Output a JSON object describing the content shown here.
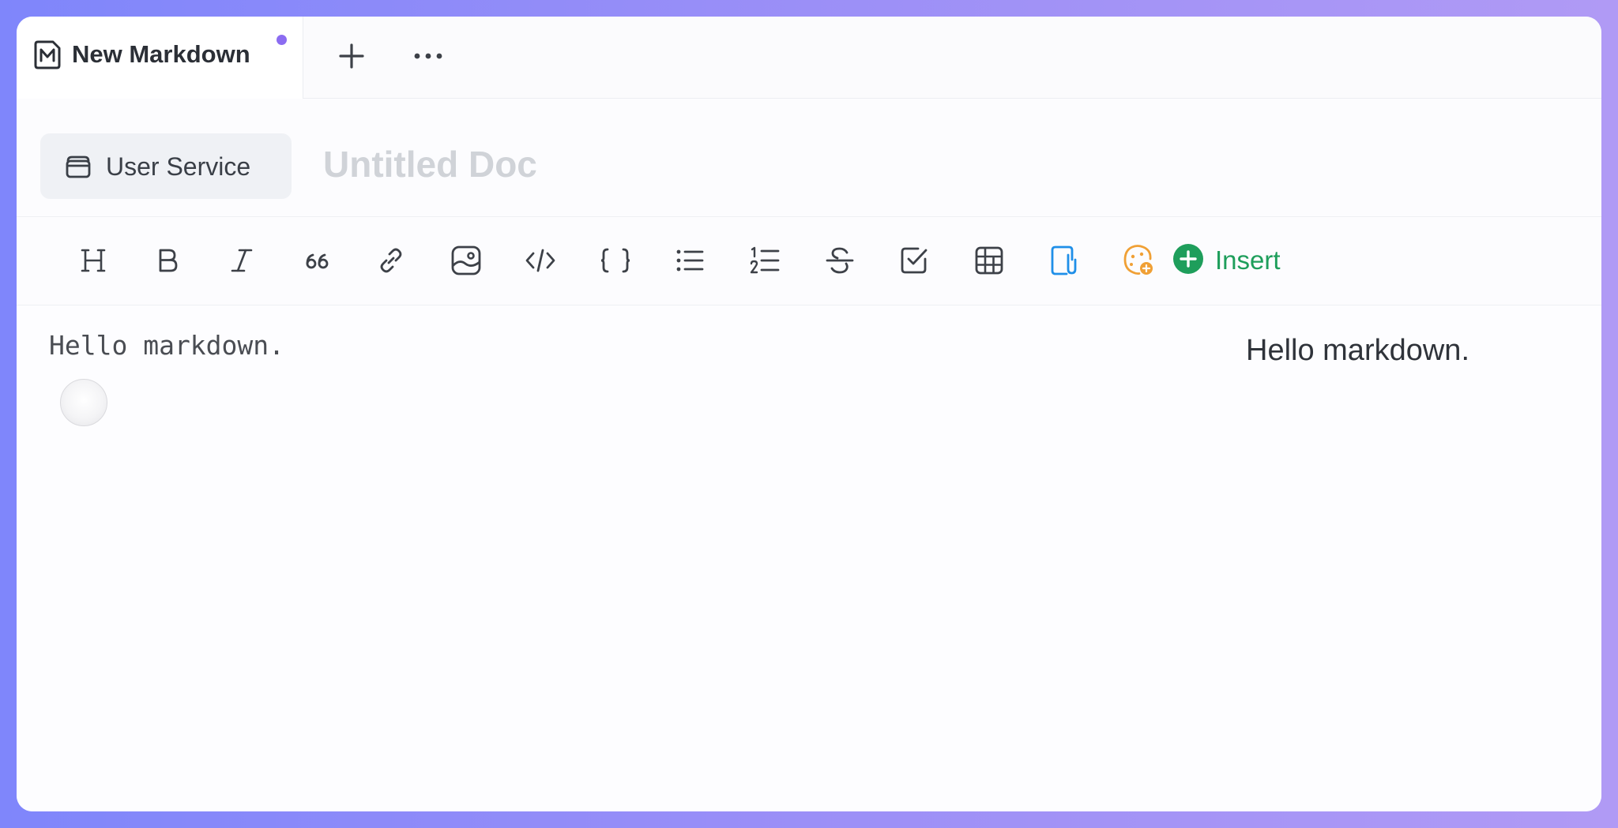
{
  "tab": {
    "title": "New Markdown",
    "icon": "markdown-file-icon",
    "unsaved": true,
    "dot_color": "#8b6cf1"
  },
  "tab_actions": {
    "add_icon": "plus-icon",
    "more_icon": "ellipsis-icon"
  },
  "doc": {
    "service_label": "User Service",
    "service_icon": "database-icon",
    "title_placeholder": "Untitled Doc"
  },
  "toolbar": {
    "items": [
      {
        "name": "heading",
        "icon": "heading-icon"
      },
      {
        "name": "bold",
        "icon": "bold-icon"
      },
      {
        "name": "italic",
        "icon": "italic-icon"
      },
      {
        "name": "quote",
        "icon": "quote-icon"
      },
      {
        "name": "link",
        "icon": "link-icon"
      },
      {
        "name": "image",
        "icon": "image-icon"
      },
      {
        "name": "code",
        "icon": "code-icon"
      },
      {
        "name": "code-block",
        "icon": "braces-icon"
      },
      {
        "name": "bullet-list",
        "icon": "bullet-list-icon"
      },
      {
        "name": "ordered-list",
        "icon": "ordered-list-icon"
      },
      {
        "name": "strikethrough",
        "icon": "strikethrough-icon"
      },
      {
        "name": "task-list",
        "icon": "checkbox-icon"
      },
      {
        "name": "table",
        "icon": "table-icon"
      },
      {
        "name": "attachment",
        "icon": "attachment-icon"
      },
      {
        "name": "emoji",
        "icon": "emoji-icon"
      }
    ],
    "insert_label": "Insert",
    "insert_icon": "plus-circle-icon",
    "accent_green": "#1e9e5b",
    "accent_blue": "#1f8fe8",
    "accent_orange": "#f0a035"
  },
  "editor": {
    "source_text": "Hello markdown.",
    "preview_text": "Hello markdown."
  }
}
